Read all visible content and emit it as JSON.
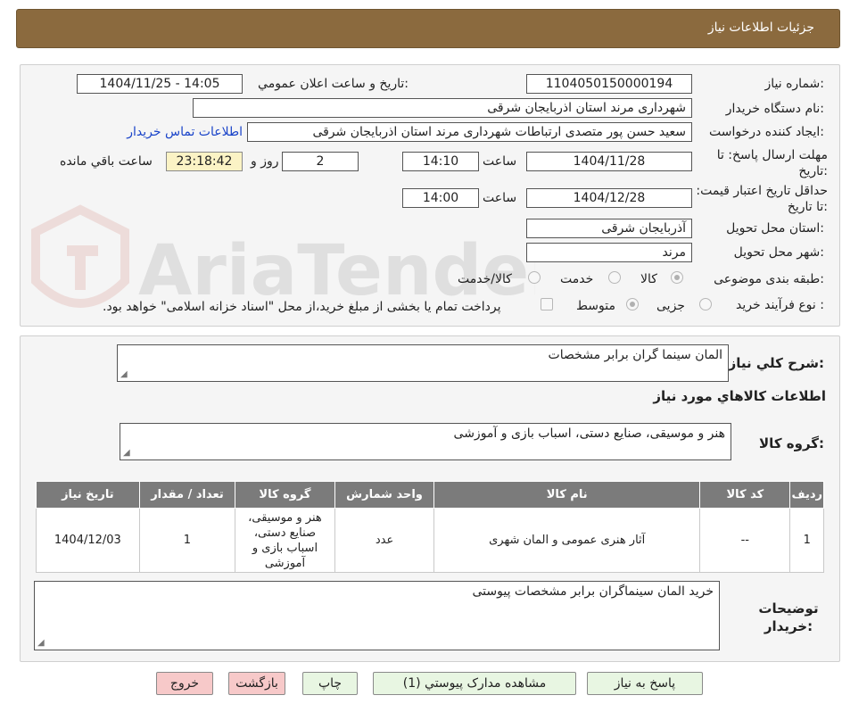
{
  "header": {
    "title": "جزئیات اطلاعات نیاز"
  },
  "watermark": {
    "text": "AriaTender.neT"
  },
  "form": {
    "need_number": {
      "label": "شماره نیاز:",
      "value": "1104050150000194"
    },
    "announce_datetime": {
      "label": "تاريخ و ساعت اعلان عمومي:",
      "value": "1404/11/25 - 14:05"
    },
    "buyer_org": {
      "label": "نام دستگاه خريدار:",
      "value": "شهرداری مرند استان اذربایجان شرقی"
    },
    "requester": {
      "label": "ایجاد کننده درخواست:",
      "value": "سعید حسن پور متصدی ارتباطات شهرداری مرند استان اذربایجان شرقی",
      "contact_link": "اطلاعات تماس خريدار"
    },
    "reply_deadline": {
      "label": "مهلت ارسال پاسخ: تا تاریخ:",
      "date": "1404/11/28",
      "time_label": "ساعت",
      "time": "14:10",
      "days": "2",
      "days_label": "روز و",
      "remaining": "23:18:42",
      "remaining_label": "ساعت باقي مانده"
    },
    "price_validity": {
      "label": "حداقل تاريخ اعتبار قيمت: تا تاريخ:",
      "date": "1404/12/28",
      "time_label": "ساعت",
      "time": "14:00"
    },
    "province": {
      "label": "استان محل تحویل:",
      "value": "آذربایجان شرقی"
    },
    "city": {
      "label": "شهر محل تحویل:",
      "value": "مرند"
    },
    "subject_class": {
      "label": "طبقه بندی موضوعی:",
      "options": [
        "کالا",
        "خدمت",
        "کالا/خدمت"
      ]
    },
    "process_type": {
      "label": "نوع فرآیند خرید :",
      "options": [
        "جزیی",
        "متوسط"
      ],
      "note": "پرداخت تمام یا بخشی از مبلغ خرید،از محل \"اسناد خزانه اسلامی\" خواهد بود."
    }
  },
  "summary": {
    "label": "شرح کلي نياز:",
    "value": "المان سینما گران برابر مشخصات",
    "goods_title": "اطلاعات کالاهاي مورد نياز",
    "group_label": "گروه کالا:",
    "group_value": "هنر و موسیقی، صنایع دستی، اسباب بازی و آموزشی"
  },
  "table": {
    "headers": [
      "رديف",
      "کد کالا",
      "نام کالا",
      "واحد شمارش",
      "گروه کالا",
      "تعداد / مقدار",
      "تاريخ نياز"
    ],
    "rows": [
      [
        "1",
        "--",
        "آثار هنری عمومی و المان شهری",
        "عدد",
        "هنر و موسیقی، صنایع دستی، اسباب بازی و آموزشی",
        "1",
        "1404/12/03"
      ]
    ]
  },
  "buyer_notes": {
    "label": "توضیحات خریدار:",
    "value": "خرید المان سینماگران برابر مشخصات پیوستی"
  },
  "buttons": {
    "reply": "پاسخ به نياز",
    "attachments": "مشاهده مدارک پيوستي (1)",
    "print": "چاپ",
    "back": "بازگشت",
    "exit": "خروج"
  },
  "colors": {
    "header_bg": "#8b6a3e",
    "table_header_bg": "#7b7b7b",
    "green_button": "#e8f6e2",
    "red_button": "#f7c9c9",
    "remaining_bg": "#fbf3c5"
  }
}
